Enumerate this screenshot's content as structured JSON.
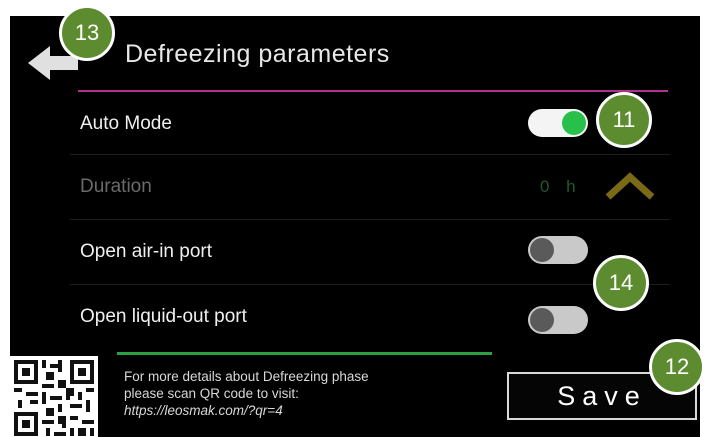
{
  "header": {
    "title": "Defreezing parameters",
    "back_icon": "back-arrow-icon"
  },
  "settings": [
    {
      "label": "Auto Mode",
      "control": "toggle",
      "on": true,
      "enabled": true
    },
    {
      "label": "Duration",
      "control": "value",
      "value": "0 h",
      "enabled": false,
      "icon": "chevron-up-icon"
    },
    {
      "label": "Open air-in port",
      "control": "toggle",
      "on": false,
      "enabled": true
    },
    {
      "label": "Open liquid-out port",
      "control": "toggle",
      "on": false,
      "enabled": true
    }
  ],
  "footer": {
    "info_lines": [
      "For more details about Defreezing phase",
      "please scan QR code to visit:"
    ],
    "url": "https://leosmak.com/?qr=4",
    "save_label": "Save"
  },
  "callouts": [
    "13",
    "11",
    "14",
    "12"
  ],
  "colors": {
    "accent_line": "#b0308a",
    "toggle_on": "#27c04a",
    "callout": "#5c8c2f",
    "footer_line": "#2aa043"
  }
}
